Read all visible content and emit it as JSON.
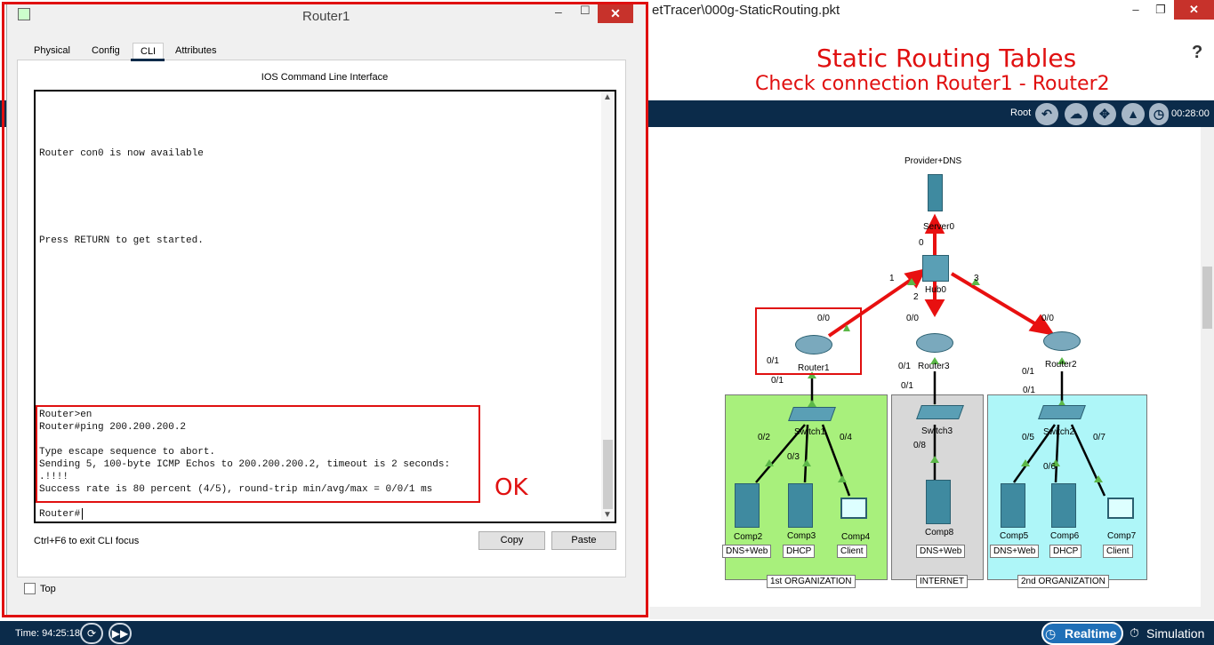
{
  "main_window": {
    "title": "etTracer\\000g-StaticRouting.pkt",
    "minimize": "–",
    "maximize": "❐",
    "close": "✕"
  },
  "lesson": {
    "title": "Static Routing Tables",
    "subtitle": "Check connection Router1 - Router2",
    "help": "?"
  },
  "toolbar": {
    "root_label": "Root",
    "time": "00:28:00",
    "icons": [
      "back-icon",
      "cloud-icon",
      "move-icon",
      "picture-icon",
      "clock-icon"
    ]
  },
  "dialog": {
    "title": "Router1",
    "tabs": [
      "Physical",
      "Config",
      "CLI",
      "Attributes"
    ],
    "selected_tab": "CLI",
    "header": "IOS Command Line Interface",
    "terminal_lines": {
      "l1": "Router con0 is now available",
      "l2": "Press RETURN to get started.",
      "l3": "Router>en",
      "l4": "Router#ping 200.200.200.2",
      "l5": "Type escape sequence to abort.",
      "l6": "Sending 5, 100-byte ICMP Echos to 200.200.200.2, timeout is 2 seconds:",
      "l7": ".!!!!",
      "l8": "Success rate is 80 percent (4/5), round-trip min/avg/max = 0/0/1 ms",
      "l9": "Router#"
    },
    "annotation": "OK",
    "focus_hint": "Ctrl+F6 to exit CLI focus",
    "copy_button": "Copy",
    "paste_button": "Paste",
    "top_checkbox_label": "Top",
    "top_checked": false
  },
  "topology": {
    "provider_label": "Provider+DNS",
    "server0": "Server0",
    "hub0": "Hub0",
    "router1": "Router1",
    "router2": "Router2",
    "router3": "Router3",
    "switch1": "Switch1",
    "switch2": "Switch2",
    "switch3": "Switch3",
    "ports": {
      "p0": "0",
      "p1": "1",
      "p2": "2",
      "p3": "3",
      "r1_00": "0/0",
      "r1_01a": "0/1",
      "r1_01b": "0/1",
      "r3_00": "0/0",
      "r3_01a": "0/1",
      "r3_01b": "0/1",
      "r2_00": "0/0",
      "r2_01a": "0/1",
      "r2_01b": "0/1",
      "s1_02": "0/2",
      "s1_03": "0/3",
      "s1_04": "0/4",
      "s3_08": "0/8",
      "s2_05": "0/5",
      "s2_06": "0/6",
      "s2_07": "0/7"
    },
    "comps": {
      "comp2": "Comp2",
      "comp3": "Comp3",
      "comp4": "Comp4",
      "comp8": "Comp8",
      "comp5": "Comp5",
      "comp6": "Comp6",
      "comp7": "Comp7"
    },
    "roles": {
      "comp2": "DNS+Web",
      "comp3": "DHCP",
      "comp4": "Client",
      "comp8": "DNS+Web",
      "comp5": "DNS+Web",
      "comp6": "DHCP",
      "comp7": "Client"
    },
    "org1": "1st ORGANIZATION",
    "internet": "INTERNET",
    "org2": "2nd ORGANIZATION",
    "colors": {
      "org1": "#a8f07c",
      "internet": "#d8d8d8",
      "org2": "#aef6f8",
      "arrow": "#e81010",
      "link": "#000000",
      "port_marker": "#5cb848"
    }
  },
  "status_bar": {
    "time": "Time: 94:25:18",
    "realtime": "Realtime",
    "simulation": "Simulation"
  }
}
